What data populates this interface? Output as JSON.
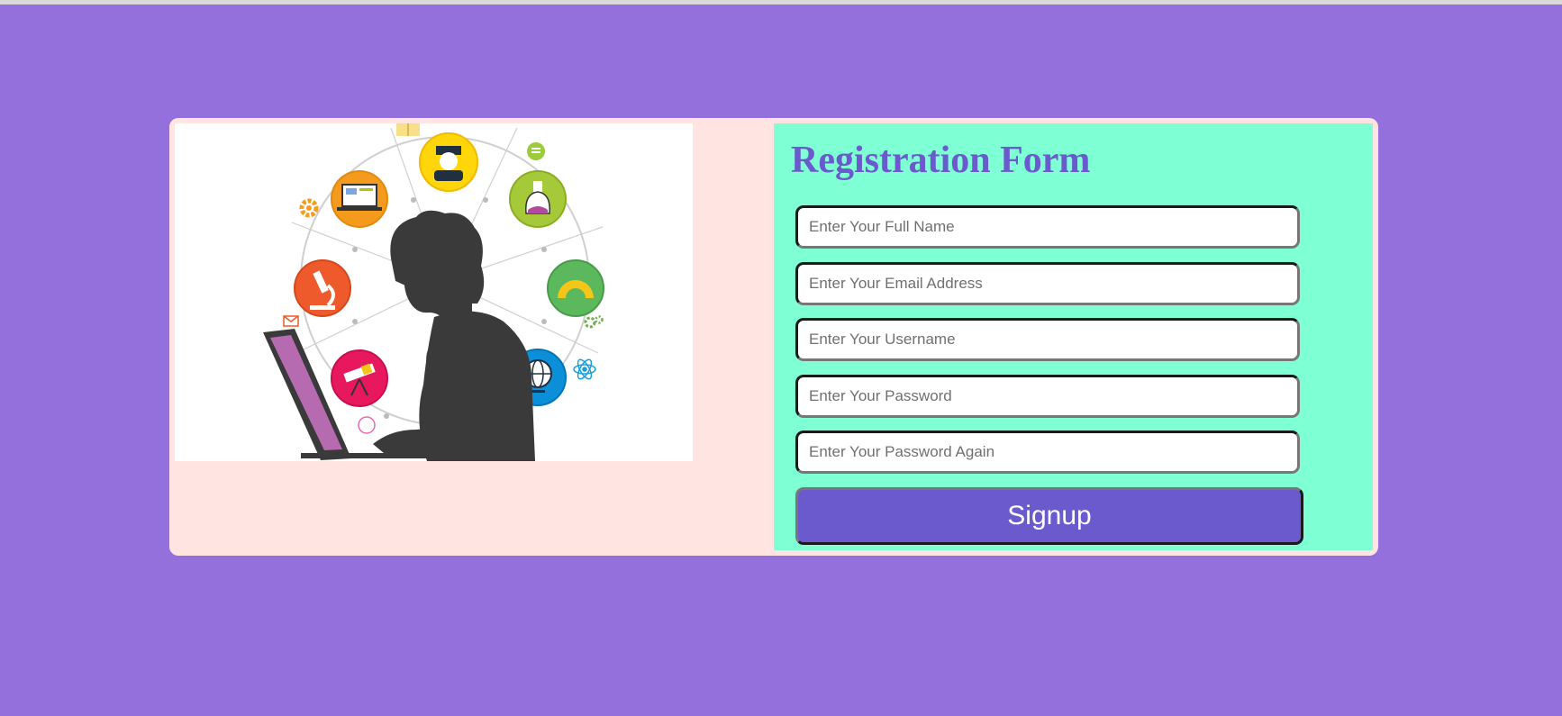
{
  "illustration": {
    "subject": "student-at-laptop",
    "icons": [
      "student-icon",
      "laptop-icon",
      "flask-icon",
      "microscope-icon",
      "protractor-icon",
      "telescope-icon",
      "globe-icon",
      "gear-icon",
      "atom-icon",
      "envelope-icon",
      "chat-icon",
      "book-icon"
    ]
  },
  "form": {
    "title": "Registration Form",
    "fields": [
      {
        "name": "full-name",
        "placeholder": "Enter Your Full Name",
        "type": "text"
      },
      {
        "name": "email",
        "placeholder": "Enter Your Email Address",
        "type": "email"
      },
      {
        "name": "username",
        "placeholder": "Enter Your Username",
        "type": "text"
      },
      {
        "name": "password",
        "placeholder": "Enter Your Password",
        "type": "password"
      },
      {
        "name": "password-again",
        "placeholder": "Enter Your Password Again",
        "type": "password"
      }
    ],
    "submit_label": "Signup"
  },
  "colors": {
    "page_bg": "#9370db",
    "card_bg": "#ffe4e1",
    "form_bg": "#7fffd4",
    "accent": "#6a5acd"
  }
}
